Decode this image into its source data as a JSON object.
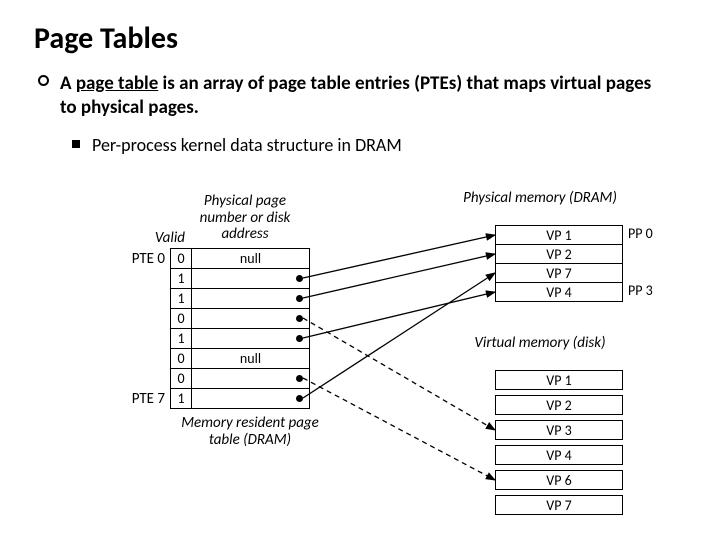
{
  "title": "Page Tables",
  "bullet_main_prefix": "A ",
  "bullet_main_term": "page table",
  "bullet_main_suffix": " is an array of page table entries (PTEs) that maps virtual pages to physical pages.",
  "bullet_sub": "Per-process kernel data structure in DRAM",
  "labels": {
    "valid": "Valid",
    "ppn": "Physical page number or disk address",
    "pte0": "PTE 0",
    "pte7": "PTE 7",
    "mrpt": "Memory resident page table (DRAM)",
    "physmem": "Physical memory (DRAM)",
    "virtmem": "Virtual memory (disk)",
    "pp0": "PP 0",
    "pp3": "PP 3"
  },
  "page_table": [
    {
      "valid": "0",
      "addr": "null"
    },
    {
      "valid": "1",
      "addr": ""
    },
    {
      "valid": "1",
      "addr": ""
    },
    {
      "valid": "0",
      "addr": ""
    },
    {
      "valid": "1",
      "addr": ""
    },
    {
      "valid": "0",
      "addr": "null"
    },
    {
      "valid": "0",
      "addr": ""
    },
    {
      "valid": "1",
      "addr": ""
    }
  ],
  "phys_mem": [
    "VP 1",
    "VP 2",
    "VP 7",
    "VP 4"
  ],
  "virt_mem": [
    "VP 1",
    "VP 2",
    "VP 3",
    "VP 4",
    "VP 6",
    "VP 7"
  ]
}
